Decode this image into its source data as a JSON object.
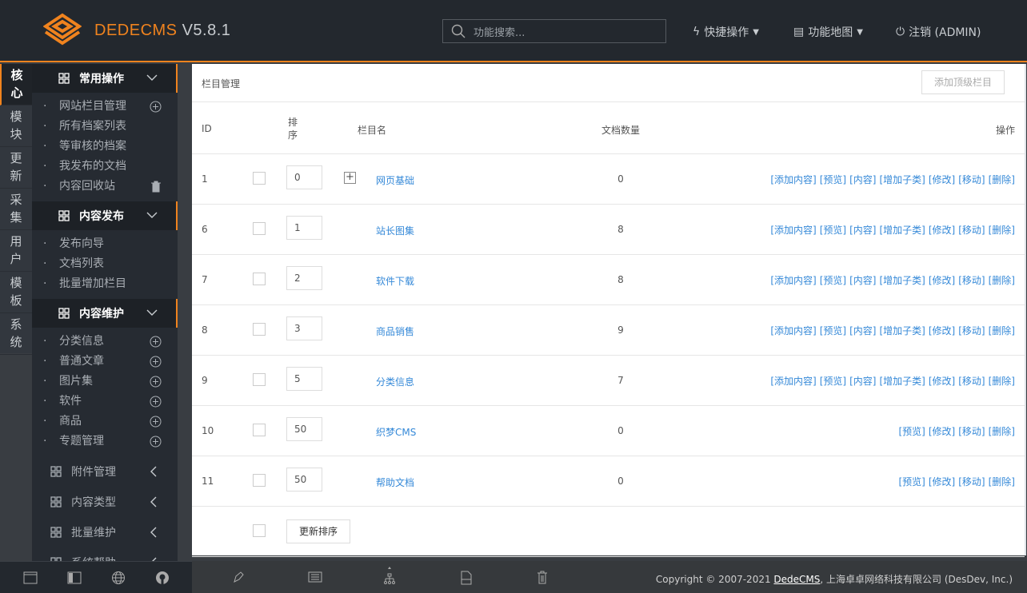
{
  "header": {
    "brand": "DEDECMS",
    "version": "V5.8.1",
    "search_placeholder": "功能搜索...",
    "quick_ops": "快捷操作",
    "func_map": "功能地图",
    "logout": "注销 (ADMIN)",
    "accent": "#f0831e"
  },
  "tabs": [
    "核心",
    "模块",
    "更新",
    "采集",
    "用户",
    "模板",
    "系统"
  ],
  "sidebar": {
    "sections": [
      {
        "title": "常用操作",
        "items": [
          {
            "label": "网站栏目管理",
            "icon": "plus-circle"
          },
          {
            "label": "所有档案列表"
          },
          {
            "label": "等审核的档案"
          },
          {
            "label": "我发布的文档"
          },
          {
            "label": "内容回收站",
            "icon": "trash"
          }
        ]
      },
      {
        "title": "内容发布",
        "items": [
          {
            "label": "发布向导"
          },
          {
            "label": "文档列表"
          },
          {
            "label": "批量增加栏目"
          }
        ]
      },
      {
        "title": "内容维护",
        "items": [
          {
            "label": "分类信息",
            "icon": "plus-circle"
          },
          {
            "label": "普通文章",
            "icon": "plus-circle"
          },
          {
            "label": "图片集",
            "icon": "plus-circle"
          },
          {
            "label": "软件",
            "icon": "plus-circle"
          },
          {
            "label": "商品",
            "icon": "plus-circle"
          },
          {
            "label": "专题管理",
            "icon": "plus-circle"
          }
        ]
      }
    ],
    "collapsed": [
      "附件管理",
      "内容类型",
      "批量维护",
      "系统帮助"
    ]
  },
  "main": {
    "title": "栏目管理",
    "add_top": "添加顶级栏目",
    "columns": {
      "id": "ID",
      "order": "排\n序",
      "name": "栏目名",
      "count": "文档数量",
      "ops": "操作"
    },
    "rows": [
      {
        "id": "1",
        "order": "0",
        "name": "网页基础",
        "count": "0",
        "expand": true,
        "ops": [
          "[添加内容]",
          "[预览]",
          "[内容]",
          "[增加子类]",
          "[修改]",
          "[移动]",
          "[删除]"
        ]
      },
      {
        "id": "6",
        "order": "1",
        "name": "站长图集",
        "count": "8",
        "ops": [
          "[添加内容]",
          "[预览]",
          "[内容]",
          "[增加子类]",
          "[修改]",
          "[移动]",
          "[删除]"
        ]
      },
      {
        "id": "7",
        "order": "2",
        "name": "软件下载",
        "count": "8",
        "ops": [
          "[添加内容]",
          "[预览]",
          "[内容]",
          "[增加子类]",
          "[修改]",
          "[移动]",
          "[删除]"
        ]
      },
      {
        "id": "8",
        "order": "3",
        "name": "商品销售",
        "count": "9",
        "ops": [
          "[添加内容]",
          "[预览]",
          "[内容]",
          "[增加子类]",
          "[修改]",
          "[移动]",
          "[删除]"
        ]
      },
      {
        "id": "9",
        "order": "5",
        "name": "分类信息",
        "count": "7",
        "ops": [
          "[添加内容]",
          "[预览]",
          "[内容]",
          "[增加子类]",
          "[修改]",
          "[移动]",
          "[删除]"
        ]
      },
      {
        "id": "10",
        "order": "50",
        "name": "织梦CMS",
        "count": "0",
        "ops": [
          "[预览]",
          "[修改]",
          "[移动]",
          "[删除]"
        ]
      },
      {
        "id": "11",
        "order": "50",
        "name": "帮助文档",
        "count": "0",
        "ops": [
          "[预览]",
          "[修改]",
          "[移动]",
          "[删除]"
        ]
      }
    ],
    "update_order": "更新排序"
  },
  "footer": {
    "copyright_prefix": "Copyright © 2007-2021 ",
    "link": "DedeCMS",
    "copyright_suffix": ", 上海卓卓网络科技有限公司 (DesDev, Inc.)"
  }
}
